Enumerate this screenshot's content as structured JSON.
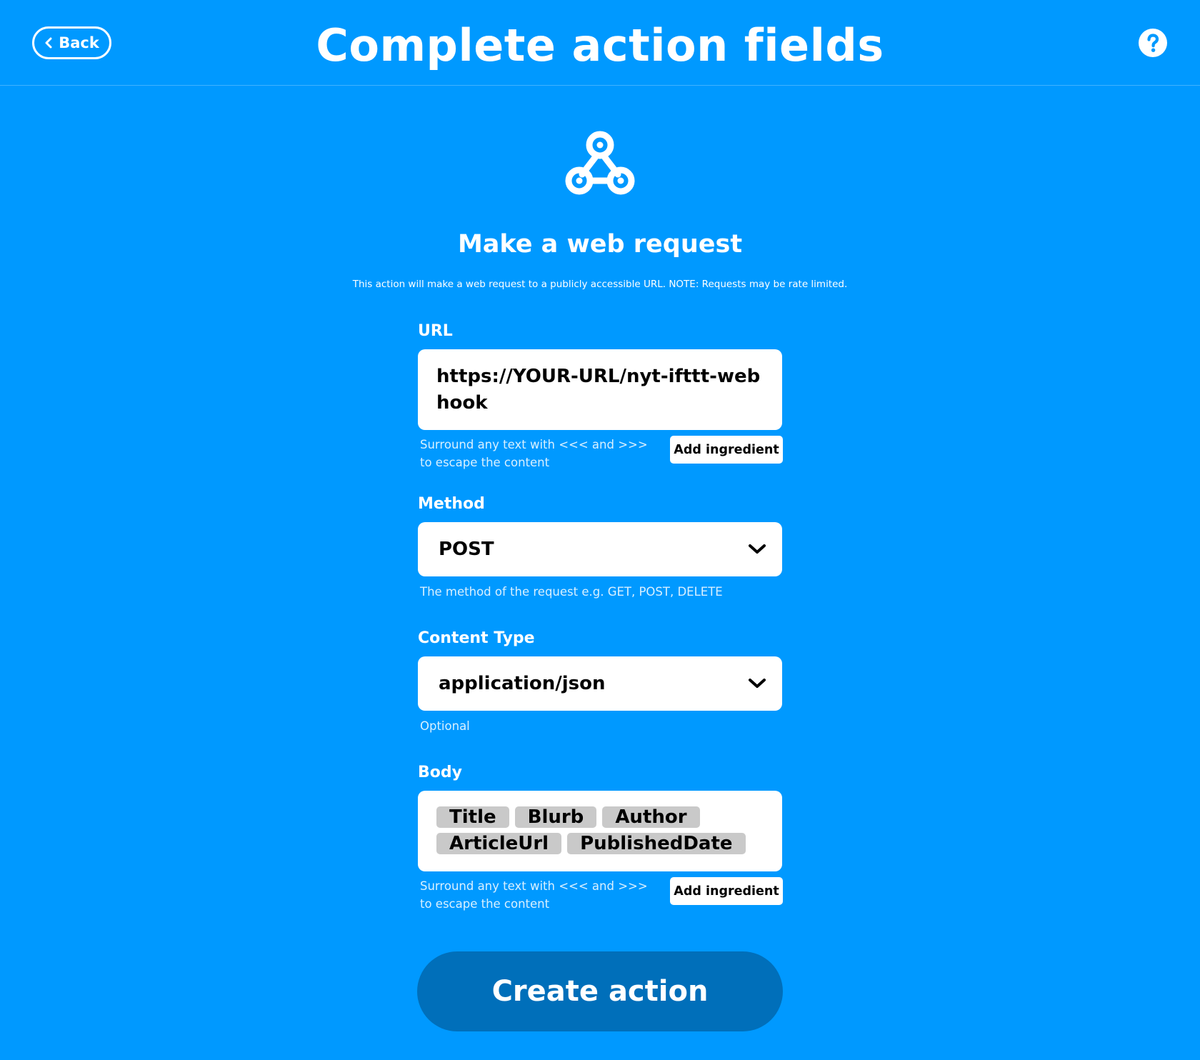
{
  "header": {
    "back_label": "Back",
    "title": "Complete action fields",
    "help_icon": "question-circle-icon"
  },
  "service": {
    "icon": "webhooks-icon",
    "action_title": "Make a web request",
    "description": "This action will make a web request to a publicly accessible URL. NOTE: Requests may be rate limited."
  },
  "fields": {
    "url": {
      "label": "URL",
      "value": "https://YOUR-URL/nyt-ifttt-webhook",
      "hint": "Surround any text with <<< and >>> to escape the content",
      "add_ingredient_label": "Add ingredient"
    },
    "method": {
      "label": "Method",
      "value": "POST",
      "hint": "The method of the request e.g. GET, POST, DELETE"
    },
    "content_type": {
      "label": "Content Type",
      "value": "application/json",
      "hint": "Optional"
    },
    "body": {
      "label": "Body",
      "ingredients": [
        "Title",
        "Blurb",
        "Author",
        "ArticleUrl",
        "PublishedDate"
      ],
      "hint": "Surround any text with <<< and >>> to escape the content",
      "add_ingredient_label": "Add ingredient"
    }
  },
  "create_action_label": "Create action",
  "colors": {
    "background": "#0099ff",
    "primary_button": "#006fba",
    "ingredient_pill": "#c9c9c9"
  }
}
